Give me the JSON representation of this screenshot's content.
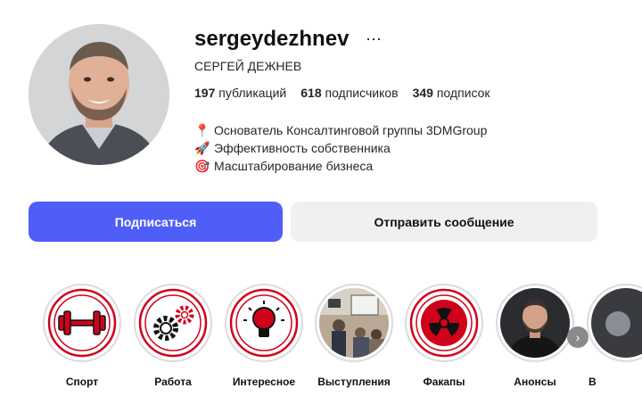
{
  "profile": {
    "username": "sergeydezhnev",
    "more_icon": "⋯",
    "full_name": "СЕРГЕЙ ДЕЖНЕВ"
  },
  "stats": {
    "posts_count": "197",
    "posts_label": "публикаций",
    "followers_count": "618",
    "followers_label": "подписчиков",
    "following_count": "349",
    "following_label": "подписок"
  },
  "bio": [
    {
      "icon": "pin-icon",
      "glyph": "📍",
      "text": "Основатель Консалтинговой группы 3DMGroup"
    },
    {
      "icon": "rocket-icon",
      "glyph": "🚀",
      "text": "Эффективность собственника"
    },
    {
      "icon": "target-icon",
      "glyph": "🎯",
      "text": "Масштабирование бизнеса"
    }
  ],
  "actions": {
    "follow_label": "Подписаться",
    "message_label": "Отправить сообщение"
  },
  "colors": {
    "accent": "#4f5ef7",
    "highlight_red": "#d0021b",
    "secondary_button": "#eff0f2"
  },
  "highlights": [
    {
      "label": "Спорт",
      "icon": "dumbbell-icon"
    },
    {
      "label": "Работа",
      "icon": "gears-icon"
    },
    {
      "label": "Интересное",
      "icon": "lightbulb-icon"
    },
    {
      "label": "Выступления",
      "icon": "presentation-photo"
    },
    {
      "label": "Факапы",
      "icon": "radiation-icon"
    },
    {
      "label": "Анонсы",
      "icon": "portrait-photo"
    },
    {
      "label": "В",
      "icon": "partial-photo"
    }
  ],
  "scroll": {
    "icon": "chevron-right-icon",
    "glyph": "›"
  }
}
